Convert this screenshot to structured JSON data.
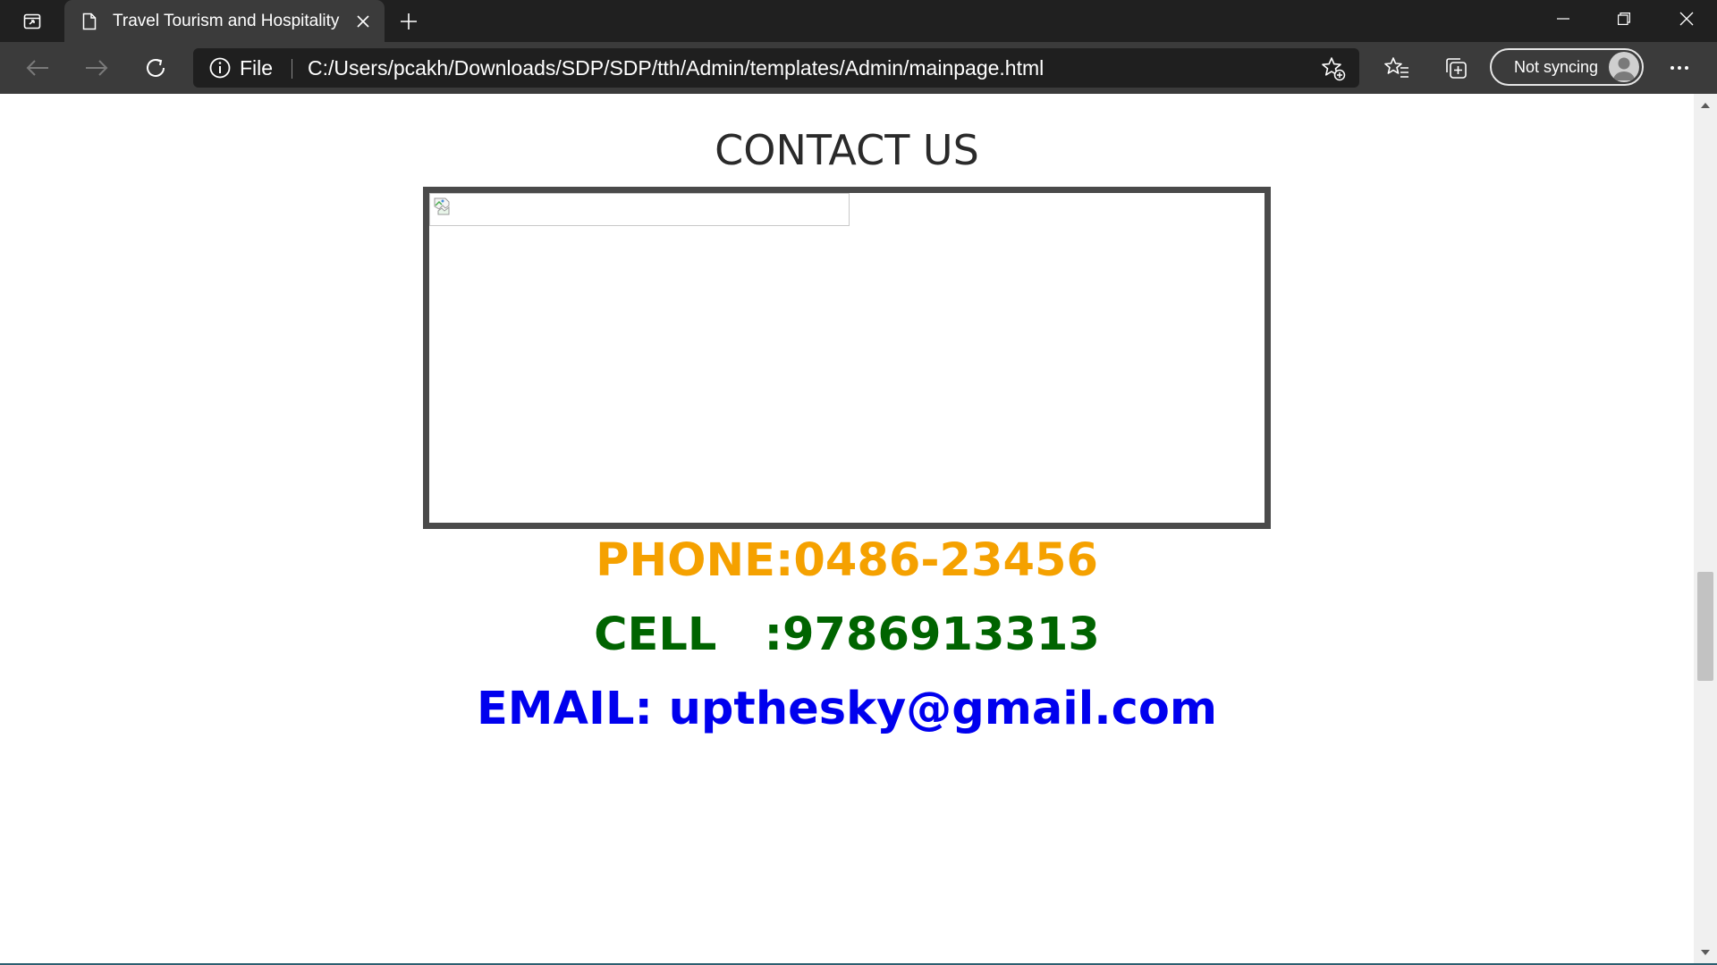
{
  "browser": {
    "tab_title": "Travel Tourism and Hospitality",
    "site_info_label": "File",
    "url": "C:/Users/pcakh/Downloads/SDP/SDP/tth/Admin/templates/Admin/mainpage.html",
    "profile_label": "Not syncing",
    "icons": {
      "tab_actions": "tab-actions-icon",
      "favicon": "page-icon",
      "tab_close": "close-icon",
      "new_tab": "plus-icon",
      "minimize": "minimize-icon",
      "restore": "restore-icon",
      "close_window": "close-icon",
      "back": "back-arrow-icon",
      "forward": "forward-arrow-icon",
      "refresh": "refresh-icon",
      "site_info": "info-icon",
      "add_favorite": "star-plus-icon",
      "favorites": "favorites-icon",
      "collections": "collections-icon",
      "more": "more-icon"
    }
  },
  "page": {
    "heading": "CONTACT US",
    "phone": "PHONE:0486-23456",
    "cell": "CELL   :9786913313",
    "email": "EMAIL: upthesky@gmail.com"
  },
  "colors": {
    "phone": "#f5a100",
    "cell": "#006400",
    "email": "#0000ee",
    "frame_border": "#4a4a4a",
    "chrome_dark": "#202020",
    "chrome_toolbar": "#3b3b3b"
  }
}
